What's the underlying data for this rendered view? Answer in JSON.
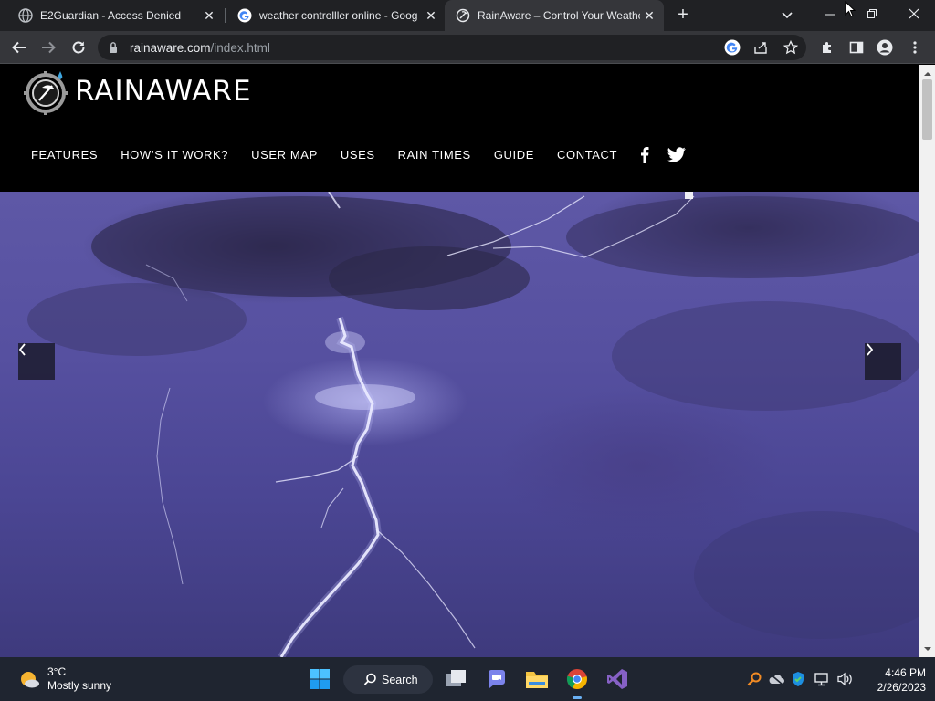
{
  "browser": {
    "tabs": [
      {
        "title": "E2Guardian - Access Denied",
        "close": "✕"
      },
      {
        "title": "weather controlller online - Goog",
        "close": "✕"
      },
      {
        "title": "RainAware – Control Your Weathe",
        "close": "✕",
        "active": true
      }
    ],
    "new_tab": "+",
    "url_host": "rainaware.com",
    "url_path": "/index.html"
  },
  "site": {
    "logo_text": "RAINAWARE",
    "nav": [
      "FEATURES",
      "HOW’S IT WORK?",
      "USER MAP",
      "USES",
      "RAIN TIMES",
      "GUIDE",
      "CONTACT"
    ],
    "social": [
      "facebook-icon",
      "twitter-icon"
    ],
    "hero": {
      "prev": "‹",
      "next": "›"
    }
  },
  "taskbar": {
    "weather_temp": "3°C",
    "weather_desc": "Mostly sunny",
    "search_label": "Search",
    "time": "4:46 PM",
    "date": "2/26/2023"
  },
  "colors": {
    "chrome_dark": "#202124",
    "chrome_toolbar": "#35363a",
    "taskbar": "#1f2530",
    "hero_sky": "#5650a0"
  }
}
